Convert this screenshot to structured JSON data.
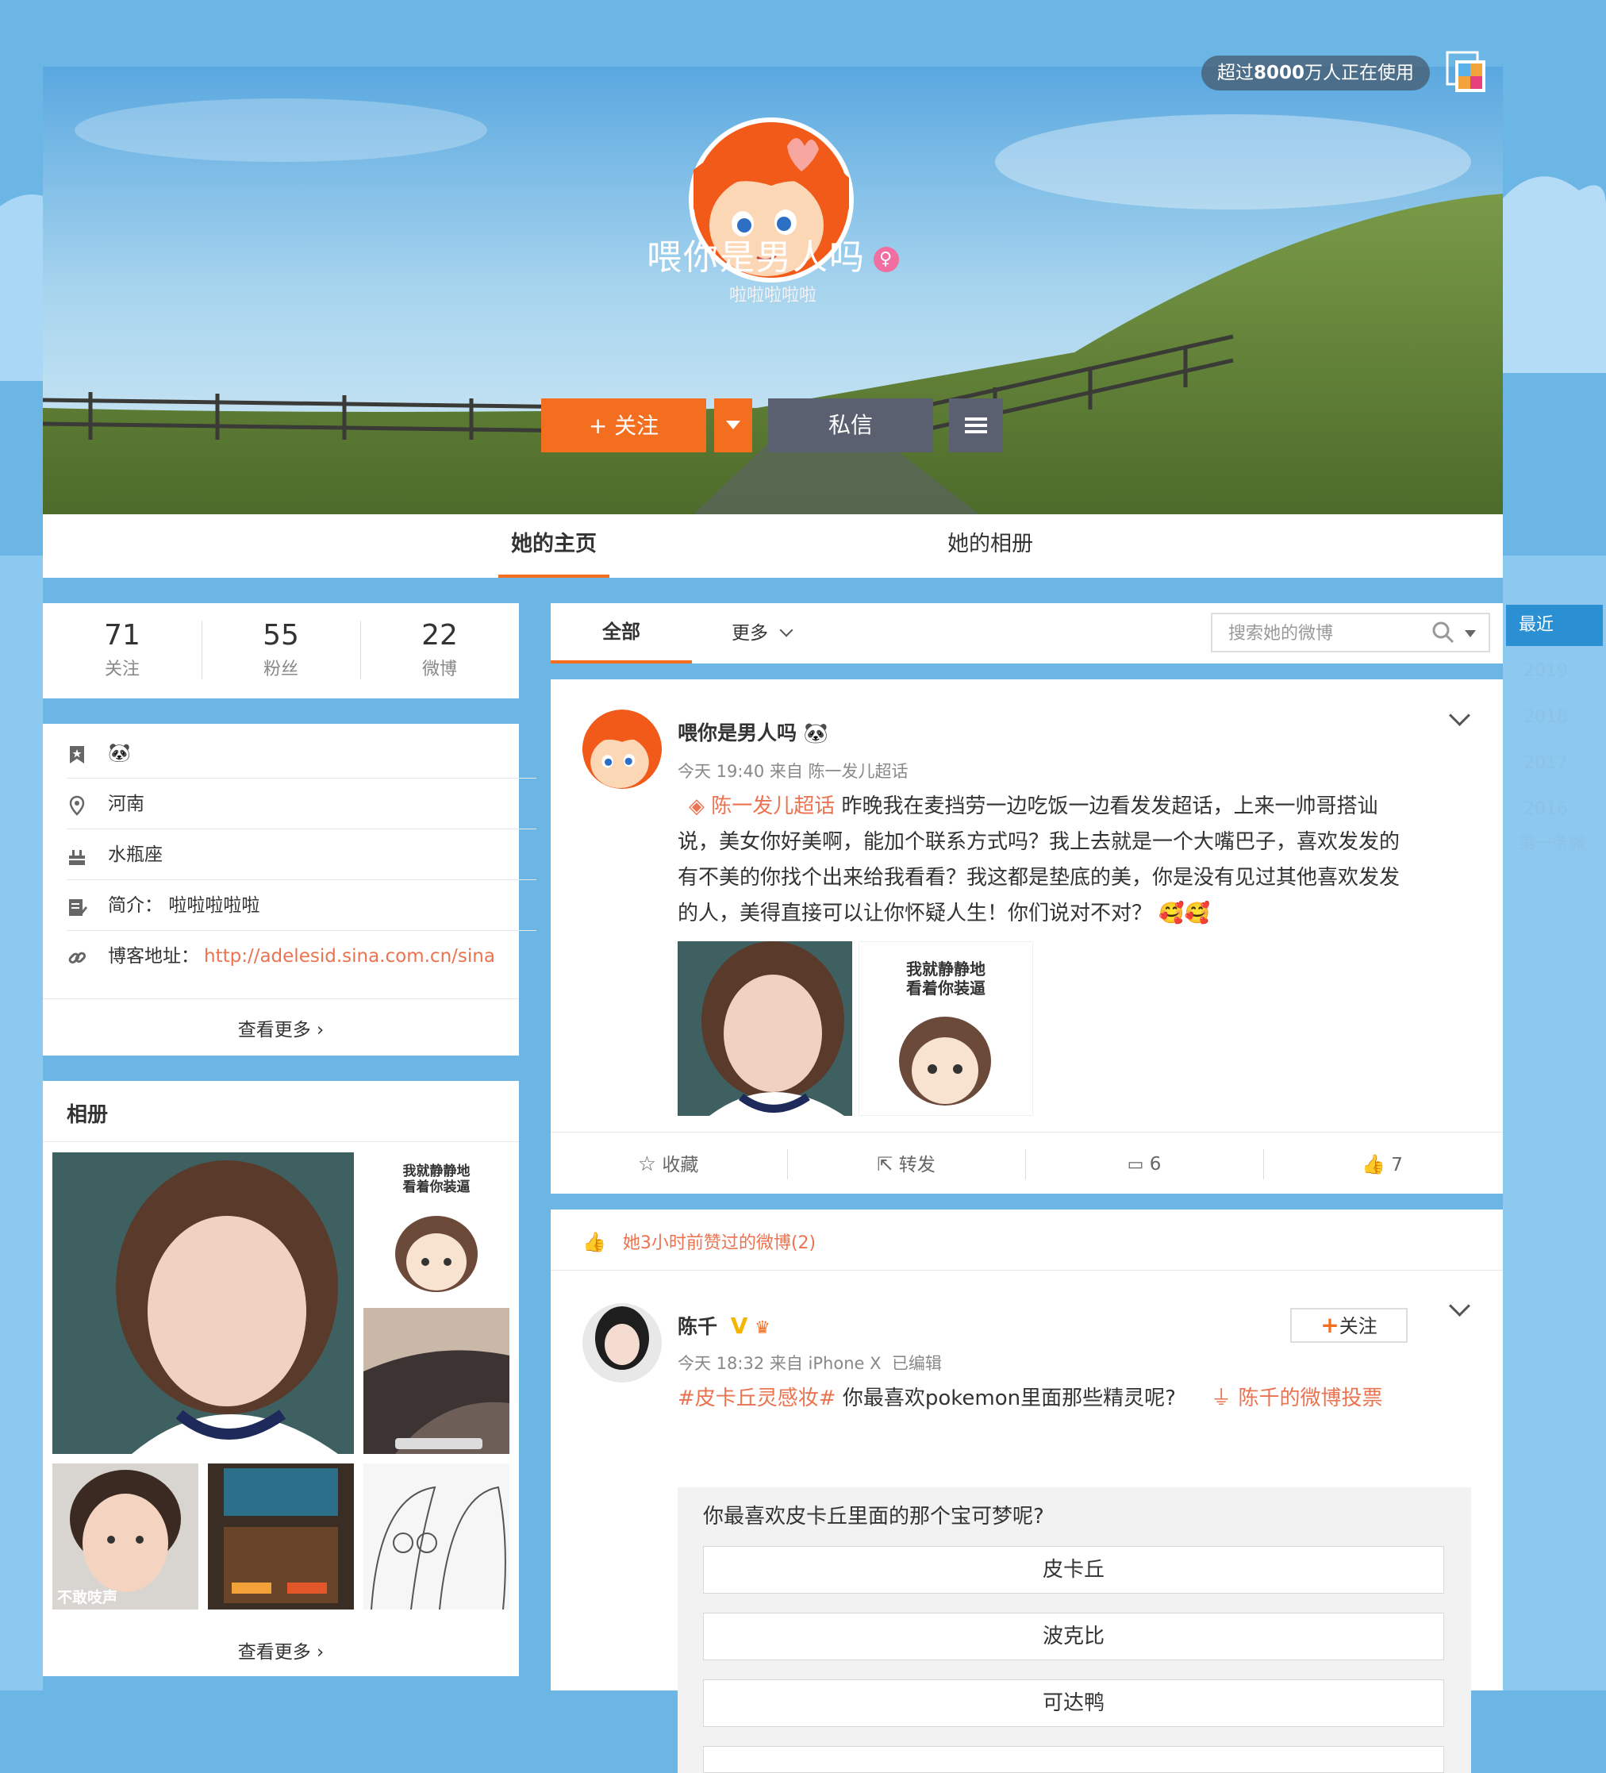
{
  "banner": {
    "usage_prefix": "超过",
    "usage_number": "8000",
    "usage_suffix": "万人正在使用",
    "profile_name": "喂你是男人吗",
    "gender_symbol": "♀",
    "bio": "啦啦啦啦啦",
    "follow_label": "+ 关注",
    "message_label": "私信"
  },
  "tabs": [
    "她的主页",
    "她的相册"
  ],
  "stats": [
    {
      "num": "71",
      "label": "关注"
    },
    {
      "num": "55",
      "label": "粉丝"
    },
    {
      "num": "22",
      "label": "微博"
    }
  ],
  "info": {
    "tag_emoji": "🐼",
    "location": "河南",
    "zodiac": "水瓶座",
    "intro_label": "简介：",
    "intro_value": "啦啦啦啦啦",
    "blog_label": "博客地址：",
    "blog_url": "http://adelesid.sina.com.cn/sina",
    "more": "查看更多"
  },
  "album": {
    "title": "相册",
    "meme_text_1": "我就静静地",
    "meme_text_2": "看着你装逼",
    "photo_caption": "不敢吱声",
    "more": "查看更多"
  },
  "feed": {
    "tab_all": "全部",
    "tab_more": "更多",
    "search_placeholder": "搜索她的微博"
  },
  "timeline": [
    "最近",
    "2019",
    "2018",
    "2017",
    "2016",
    "第一条微"
  ],
  "post1": {
    "name": "喂你是男人吗",
    "name_emoji": "🐼",
    "meta": "今天 19:40 来自 陈一发儿超话",
    "topic": "陈一发儿超话",
    "lines": [
      "昨晚我在麦挡劳一边吃饭一边看发发超话，上来一帅哥搭讪",
      "说，美女你好美啊，能加个联系方式吗？我上去就是一个大嘴巴子，喜欢发发的",
      "有不美的你找个出来给我看看？我这都是垫底的美，你是没有见过其他喜欢发发",
      "的人，美得直接可以让你怀疑人生！你们说对不对？"
    ],
    "line_end_emoji": "🥰🥰",
    "meme_text_1": "我就静静地",
    "meme_text_2": "看着你装逼",
    "actions": {
      "collect": "收藏",
      "repost": "转发",
      "comments": "6",
      "likes": "7"
    }
  },
  "liked_header": "她3小时前赞过的微博(2)",
  "post2": {
    "name": "陈千",
    "verified_badge": "V",
    "meta": "今天 18:32 来自 iPhone X  已编辑",
    "follow_label": "关注",
    "hashtag": "#皮卡丘灵感妆#",
    "text": " 你最喜欢pokemon里面那些精灵呢?",
    "vote_link": "陈千的微博投票",
    "vote_question": "你最喜欢皮卡丘里面的那个宝可梦呢?",
    "vote_options": [
      "皮卡丘",
      "波克比",
      "可达鸭"
    ]
  }
}
